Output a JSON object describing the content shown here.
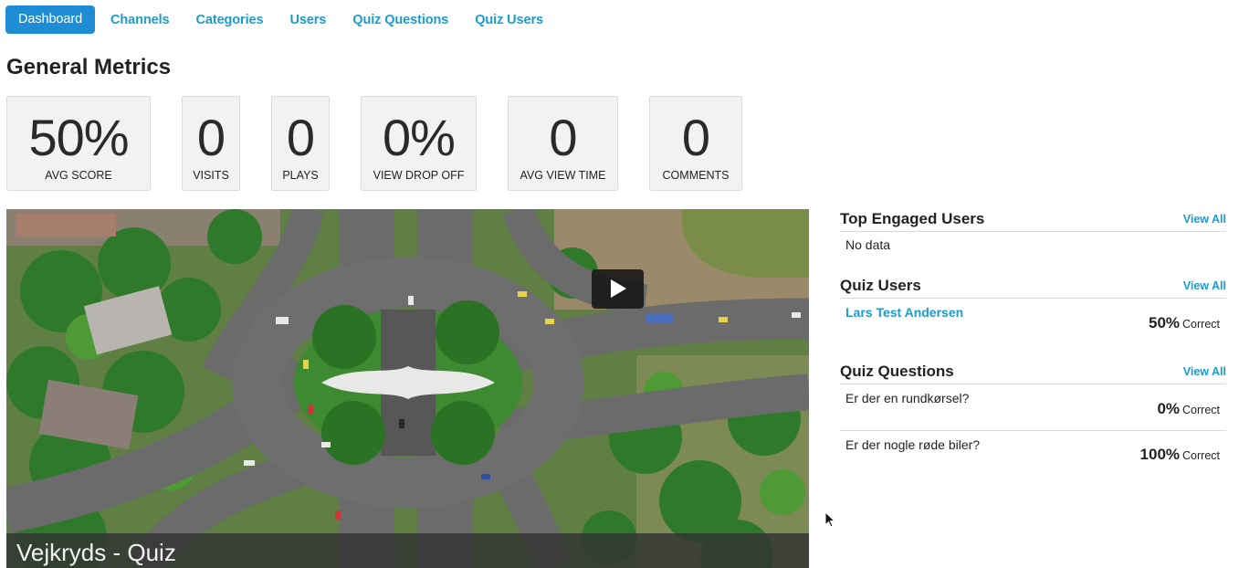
{
  "nav": {
    "items": [
      "Dashboard",
      "Channels",
      "Categories",
      "Users",
      "Quiz Questions",
      "Quiz Users"
    ],
    "active": "Dashboard"
  },
  "page_title": "General Metrics",
  "metrics": [
    {
      "value": "50%",
      "label": "AVG SCORE"
    },
    {
      "value": "0",
      "label": "VISITS"
    },
    {
      "value": "0",
      "label": "PLAYS"
    },
    {
      "value": "0%",
      "label": "VIEW DROP OFF"
    },
    {
      "value": "0",
      "label": "AVG VIEW TIME"
    },
    {
      "value": "0",
      "label": "COMMENTS"
    }
  ],
  "video": {
    "title": "Vejkryds - Quiz",
    "play_icon": "play-icon"
  },
  "top_engaged_users": {
    "title": "Top Engaged Users",
    "view_all": "View All",
    "empty_text": "No data"
  },
  "quiz_users": {
    "title": "Quiz Users",
    "view_all": "View All",
    "items": [
      {
        "name": "Lars Test Andersen",
        "score": "50%",
        "suffix": "Correct"
      }
    ]
  },
  "quiz_questions": {
    "title": "Quiz Questions",
    "view_all": "View All",
    "items": [
      {
        "question": "Er der en rundkørsel?",
        "score": "0%",
        "suffix": "Correct"
      },
      {
        "question": "Er der nogle røde biler?",
        "score": "100%",
        "suffix": "Correct"
      }
    ]
  },
  "colors": {
    "accent": "#1a9cd1",
    "active_tab": "#1f8dd6",
    "card_bg": "#f2f2f2"
  }
}
